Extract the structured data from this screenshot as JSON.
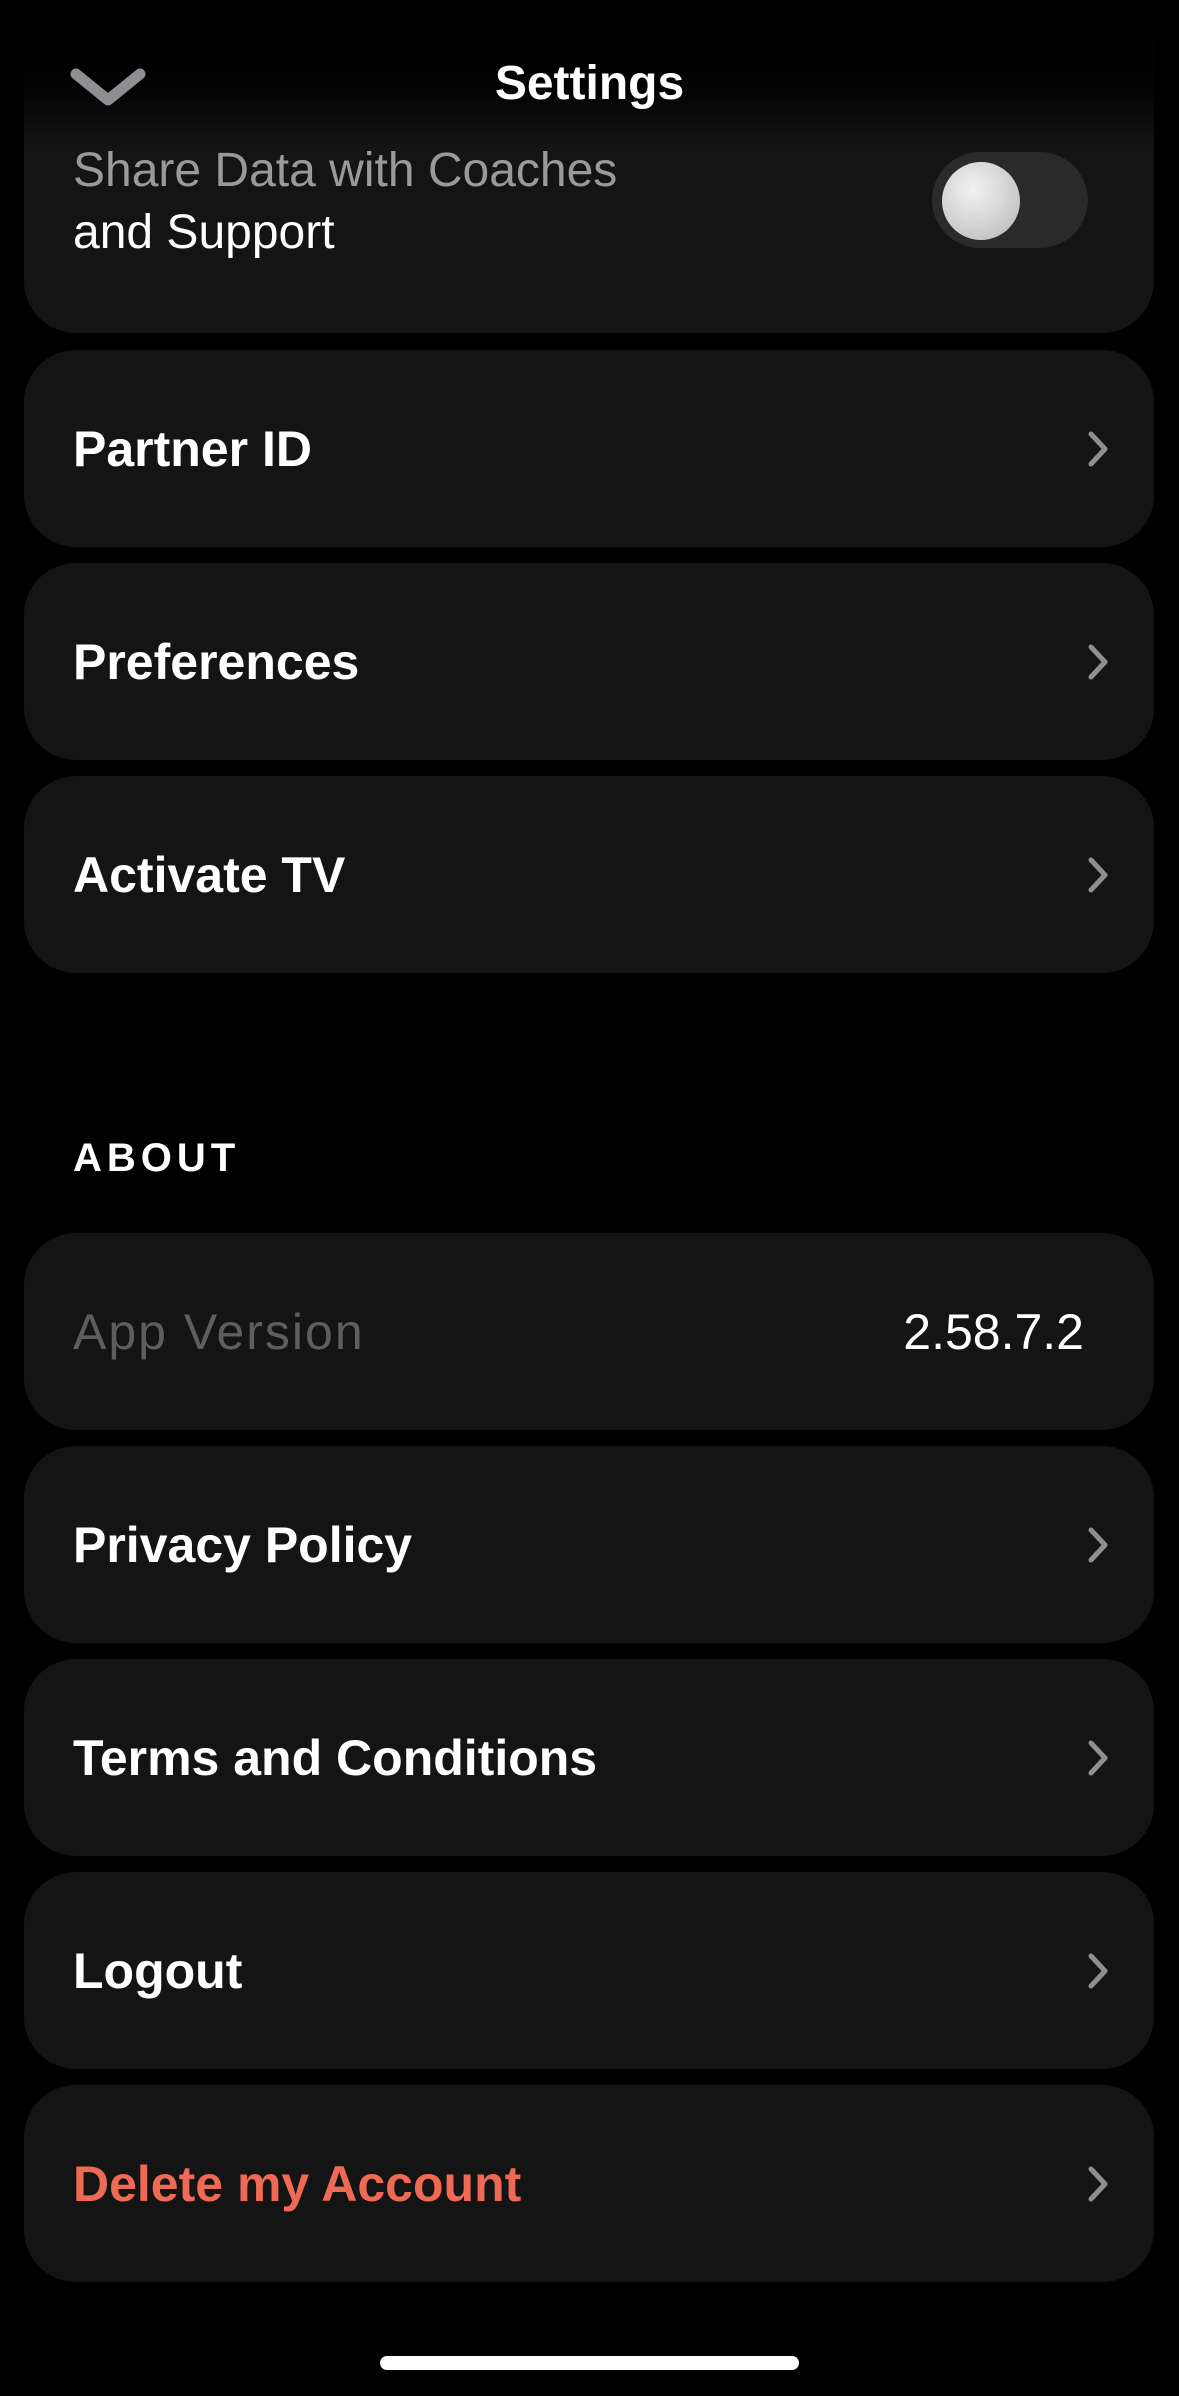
{
  "header": {
    "title": "Settings",
    "collapse_icon": "chevron-down-icon"
  },
  "share_data": {
    "label_line1": "Share Data with Coaches",
    "label_line2": "and Support",
    "toggle_on": false
  },
  "rows": [
    {
      "label": "Partner ID"
    },
    {
      "label": "Preferences"
    },
    {
      "label": "Activate TV"
    }
  ],
  "about": {
    "section_title": "ABOUT",
    "app_version_label": "App Version",
    "app_version_value": "2.58.7.2",
    "rows": [
      {
        "label": "Privacy Policy"
      },
      {
        "label": "Terms and Conditions"
      },
      {
        "label": "Logout"
      },
      {
        "label": "Delete my Account"
      }
    ]
  },
  "colors": {
    "background": "#000000",
    "card": "#141414",
    "danger": "#ee6a55",
    "muted_text": "#5e5e5e",
    "secondary_text": "#9a9a9a",
    "chevron": "#8e8e93"
  }
}
